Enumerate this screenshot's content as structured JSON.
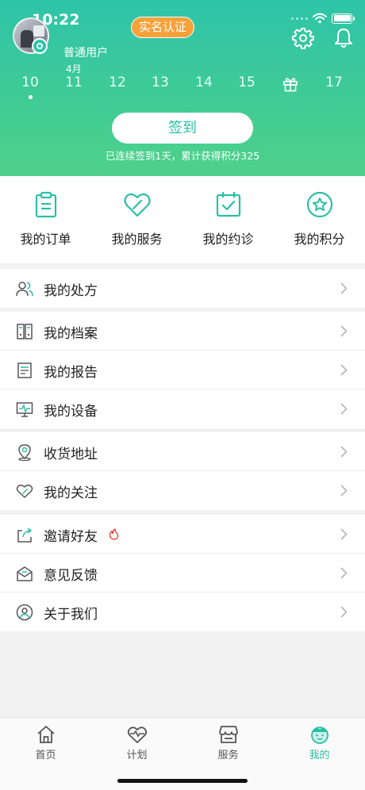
{
  "status_bar": {
    "time": "10:22"
  },
  "profile": {
    "user_type": "普通用户",
    "cert_badge": "实名认证"
  },
  "calendar": {
    "month": "4月",
    "days": [
      "10",
      "11",
      "12",
      "13",
      "14",
      "15",
      "17"
    ],
    "gift_day_icon": "gift-icon",
    "today": "10"
  },
  "checkin": {
    "button": "签到",
    "info": "已连续签到1天，累计获得积分325"
  },
  "quick_actions": [
    {
      "label": "我的订单",
      "icon": "clipboard-icon"
    },
    {
      "label": "我的服务",
      "icon": "heart-icon"
    },
    {
      "label": "我的约诊",
      "icon": "calendar-check-icon"
    },
    {
      "label": "我的积分",
      "icon": "star-icon"
    }
  ],
  "menu_groups": [
    [
      {
        "label": "我的处方",
        "icon": "users-icon"
      }
    ],
    [
      {
        "label": "我的档案",
        "icon": "folder-icon"
      },
      {
        "label": "我的报告",
        "icon": "report-icon"
      },
      {
        "label": "我的设备",
        "icon": "monitor-icon"
      }
    ],
    [
      {
        "label": "收货地址",
        "icon": "location-icon"
      },
      {
        "label": "我的关注",
        "icon": "heart-icon"
      }
    ],
    [
      {
        "label": "邀请好友",
        "icon": "share-icon",
        "hot": true
      },
      {
        "label": "意见反馈",
        "icon": "mail-icon"
      },
      {
        "label": "关于我们",
        "icon": "user-circle-icon"
      }
    ]
  ],
  "tabbar": [
    {
      "label": "首页",
      "icon": "home-icon",
      "active": false
    },
    {
      "label": "计划",
      "icon": "heart-pulse-icon",
      "active": false
    },
    {
      "label": "服务",
      "icon": "store-icon",
      "active": false
    },
    {
      "label": "我的",
      "icon": "face-icon",
      "active": true
    }
  ],
  "colors": {
    "accent": "#2bbfa6",
    "header_start": "#2ec4a8",
    "header_end": "#4ed189",
    "badge": "#f7a13a",
    "hot": "#f0443a"
  }
}
